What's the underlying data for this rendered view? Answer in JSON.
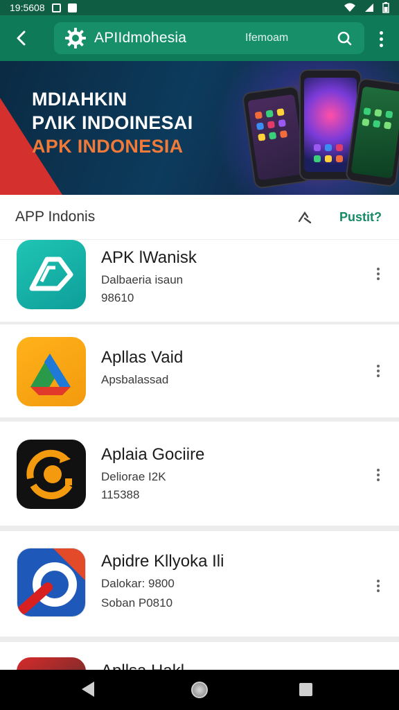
{
  "status_bar": {
    "time": "19:5608"
  },
  "app_bar": {
    "title": "APIIdmohesia",
    "subtitle": "Ifemoam",
    "back_icon": "arrow-left-icon",
    "gear_icon": "gear-icon",
    "search_icon": "search-icon",
    "more_icon": "more-vert-icon",
    "color": "#0f7a58"
  },
  "banner": {
    "line1": "MDIAHKIN",
    "line2": "PΛIK INDOINESAI",
    "line3": "APK INDONESIA",
    "accent_color": "#f07a3a"
  },
  "section": {
    "title": "APP Indonis",
    "action_label": "Pustit?",
    "action_color": "#148a66"
  },
  "apps": [
    {
      "name": "APK lWanisk",
      "line1": "Dalbaeria isaun",
      "line2": "98610",
      "icon": "apk-logo-icon"
    },
    {
      "name": "Apllas Vaid",
      "line1": "Apsbalassad",
      "line2": "",
      "icon": "drive-logo-icon"
    },
    {
      "name": "Aplaia Gociire",
      "line1": "Deliorae I2K",
      "line2": "115388",
      "icon": "rotate-logo-icon"
    },
    {
      "name": "Apidre Kllyoka Ili",
      "line1": "Dalokar: 9800",
      "line2": "Soban P0810",
      "icon": "ring-logo-icon"
    },
    {
      "name": "Apllsa Hakl",
      "line1": "",
      "line2": "",
      "icon": "red-logo-icon"
    }
  ],
  "nav_bar": {
    "back_icon": "triangle-back-icon",
    "home_icon": "circle-home-icon",
    "recents_icon": "square-recents-icon"
  }
}
